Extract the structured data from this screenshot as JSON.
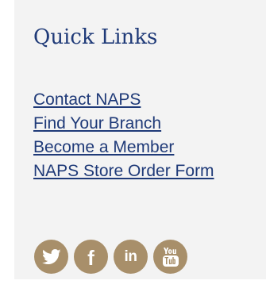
{
  "quick_links": {
    "title": "Quick Links",
    "links": [
      {
        "label": "Contact NAPS"
      },
      {
        "label": "Find Your Branch"
      },
      {
        "label": "Become a Member"
      },
      {
        "label": "NAPS Store Order Form"
      }
    ]
  },
  "social": {
    "icons": [
      {
        "name": "twitter-icon"
      },
      {
        "name": "facebook-icon",
        "glyph": "f"
      },
      {
        "name": "linkedin-icon",
        "glyph": "in"
      },
      {
        "name": "youtube-icon",
        "lettering": "You Tube"
      }
    ]
  },
  "colors": {
    "panel_background": "#f3f3f3",
    "link_text": "#1f3a78",
    "social_icon_background": "#a88f6a",
    "social_icon_glyph": "#ffffff"
  }
}
